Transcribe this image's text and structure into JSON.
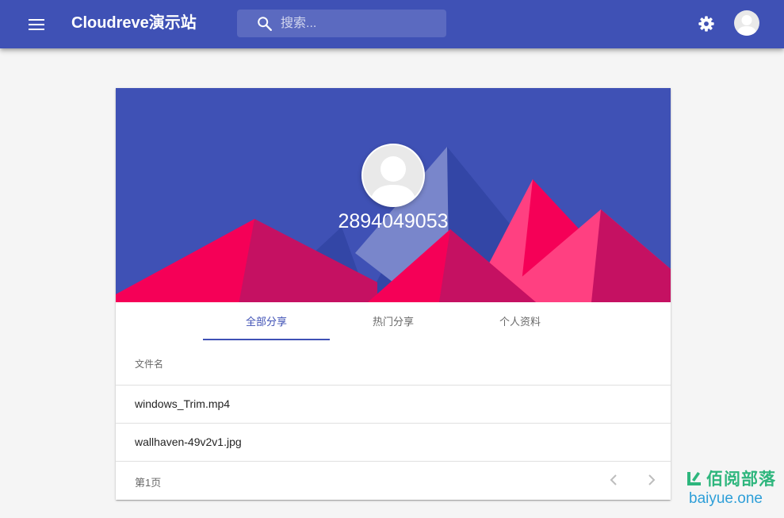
{
  "header": {
    "title": "Cloudreve演示站",
    "search_placeholder": "搜索...",
    "menu_icon": "menu-icon",
    "settings_icon": "gear-icon",
    "account_icon": "avatar-icon"
  },
  "profile": {
    "user_id": "2894049053",
    "colors": {
      "banner": "#3f51b5",
      "accent_pink": "#f50057"
    }
  },
  "tabs": [
    {
      "label": "全部分享",
      "active": true
    },
    {
      "label": "热门分享",
      "active": false
    },
    {
      "label": "个人资料",
      "active": false
    }
  ],
  "table": {
    "column_header": "文件名",
    "rows": [
      {
        "name": "windows_Trim.mp4"
      },
      {
        "name": "wallhaven-49v2v1.jpg"
      }
    ]
  },
  "pagination": {
    "label": "第1页",
    "prev_icon": "chevron-left-icon",
    "next_icon": "chevron-right-icon"
  },
  "watermark": {
    "text": "佰阅部落",
    "url": "baiyue.one"
  }
}
